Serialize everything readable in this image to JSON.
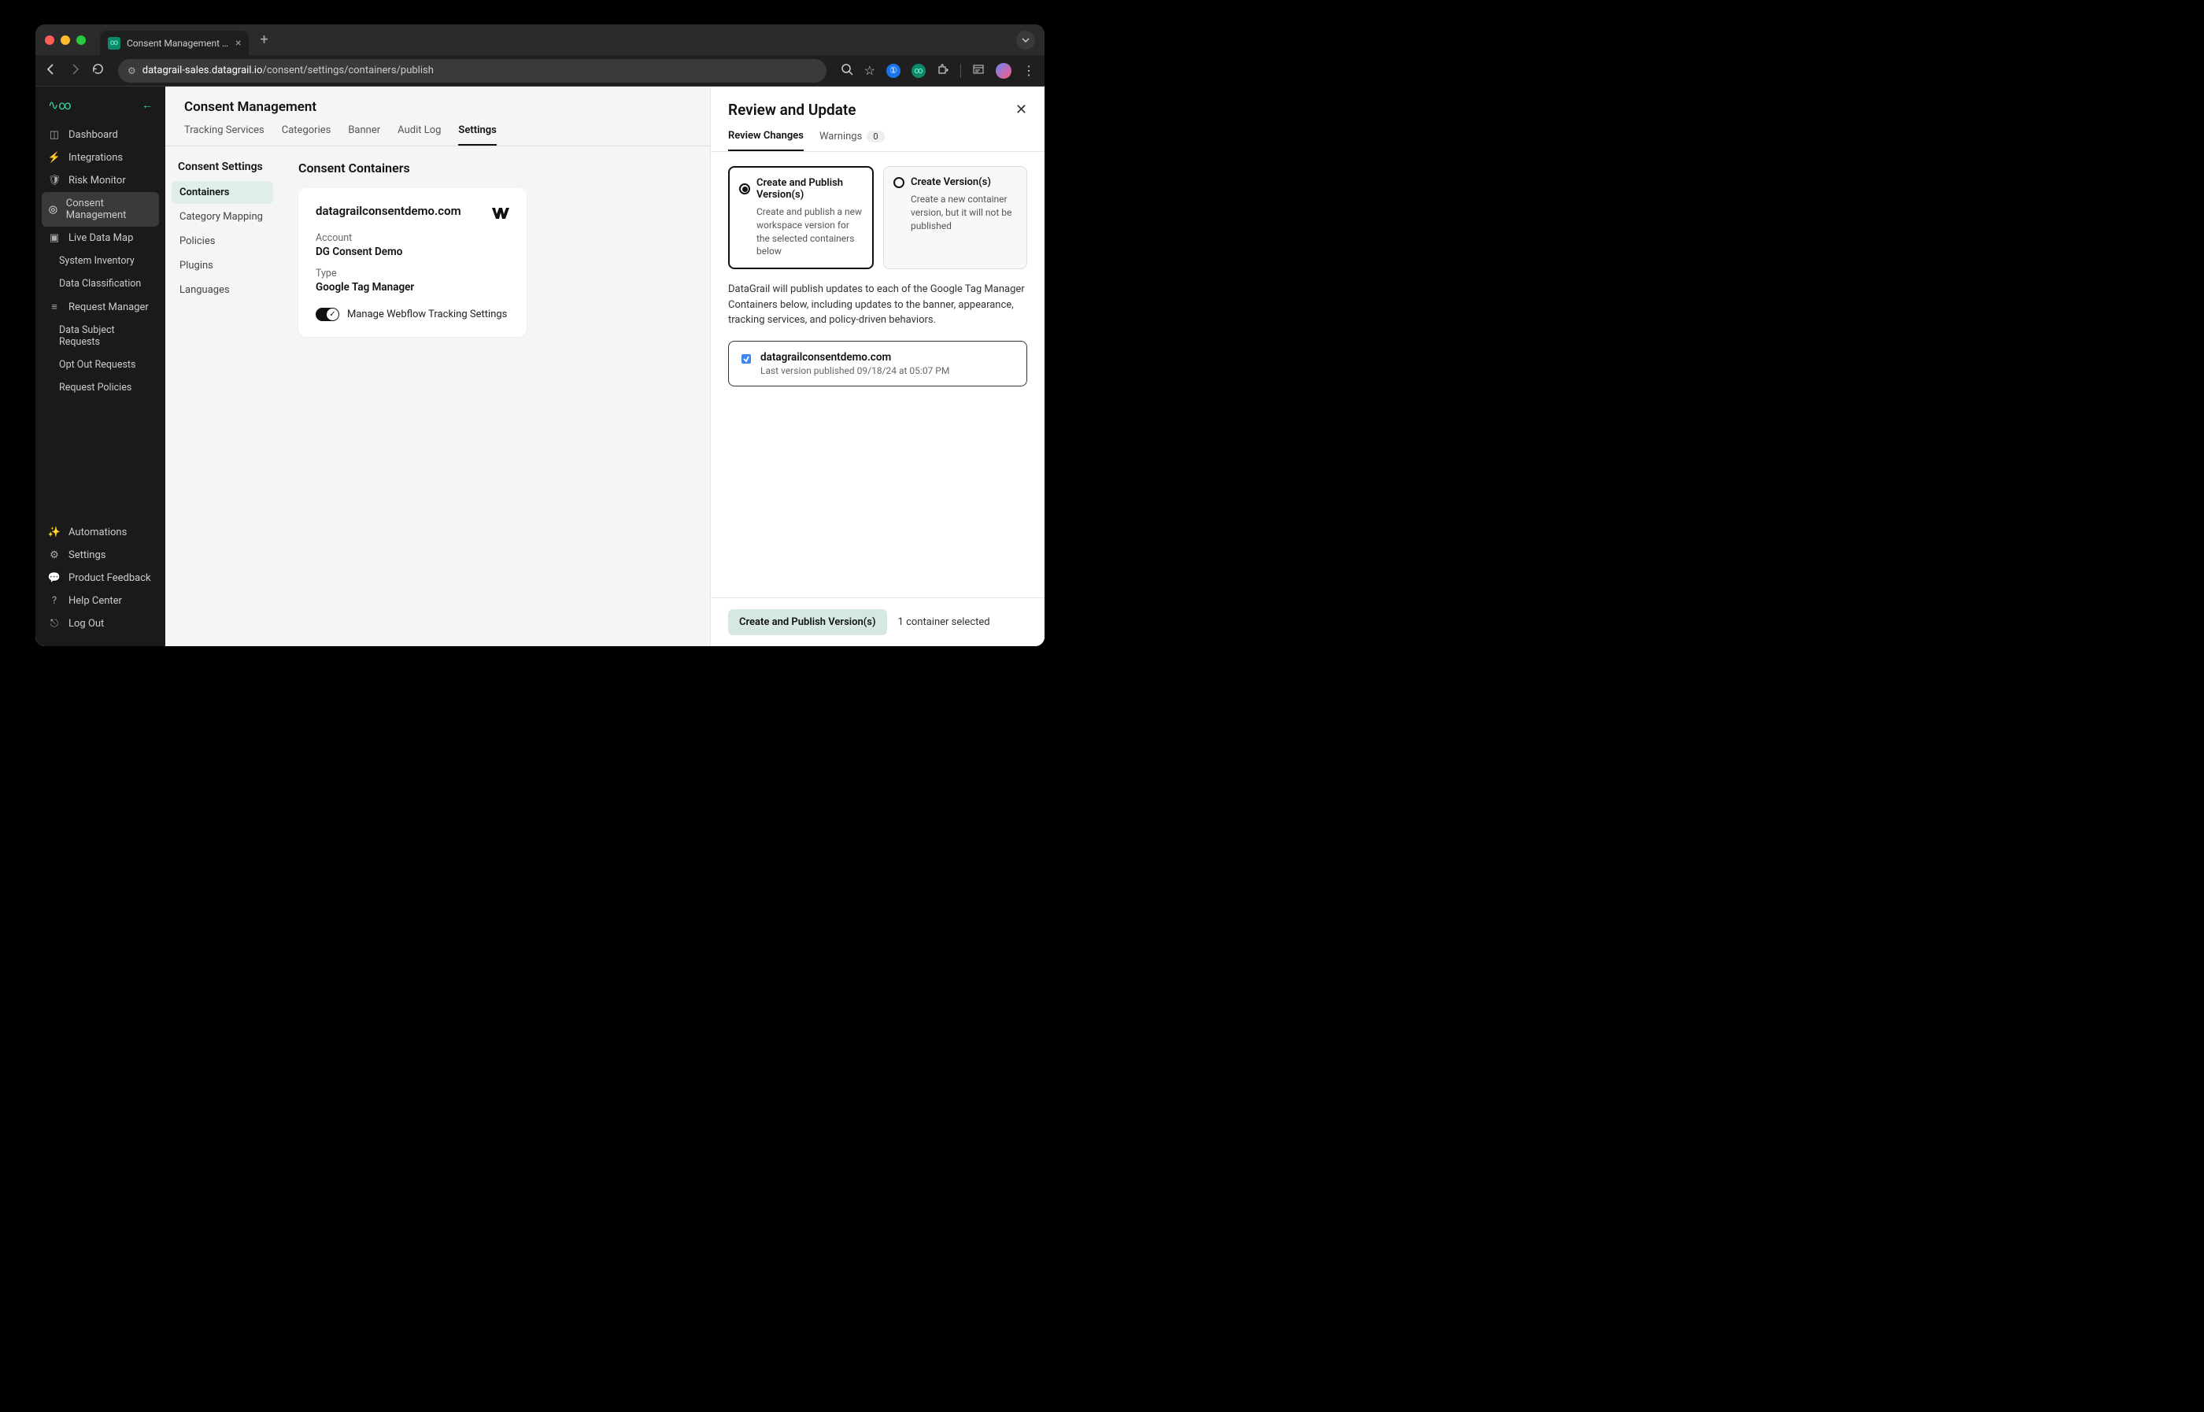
{
  "browser": {
    "tab_title": "Consent Management | DataG…",
    "url_host": "datagrail-sales.datagrail.io",
    "url_path": "/consent/settings/containers/publish"
  },
  "sidebar": {
    "items": [
      "Dashboard",
      "Integrations",
      "Risk Monitor",
      "Consent Management",
      "Live Data Map",
      "System Inventory",
      "Data Classification",
      "Request Manager",
      "Data Subject Requests",
      "Opt Out Requests",
      "Request Policies"
    ],
    "bottom": [
      "Automations",
      "Settings",
      "Product Feedback",
      "Help Center",
      "Log Out"
    ]
  },
  "header": {
    "title": "Consent Management"
  },
  "tabs": [
    "Tracking Services",
    "Categories",
    "Banner",
    "Audit Log",
    "Settings"
  ],
  "subnav": {
    "title": "Consent Settings",
    "items": [
      "Containers",
      "Category Mapping",
      "Policies",
      "Plugins",
      "Languages"
    ]
  },
  "panel": {
    "title": "Consent Containers",
    "card": {
      "domain": "datagrailconsentdemo.com",
      "account_label": "Account",
      "account_value": "DG Consent Demo",
      "type_label": "Type",
      "type_value": "Google Tag Manager",
      "toggle_label": "Manage Webflow Tracking Settings"
    }
  },
  "review": {
    "title": "Review and Update",
    "tab_review": "Review Changes",
    "tab_warnings": "Warnings",
    "warnings_count": "0",
    "option_publish_title": "Create and Publish Version(s)",
    "option_publish_desc": "Create and publish a new workspace version for the selected containers below",
    "option_create_title": "Create Version(s)",
    "option_create_desc": "Create a new container version, but it will not be published",
    "info": "DataGrail will publish updates to each of the Google Tag Manager Containers below, including updates to the banner, appearance, tracking services, and policy-driven behaviors.",
    "container_title": "datagrailconsentdemo.com",
    "container_sub": "Last version published 09/18/24 at 05:07 PM",
    "button_publish": "Create and Publish Version(s)",
    "selection_text": "1 container selected"
  }
}
